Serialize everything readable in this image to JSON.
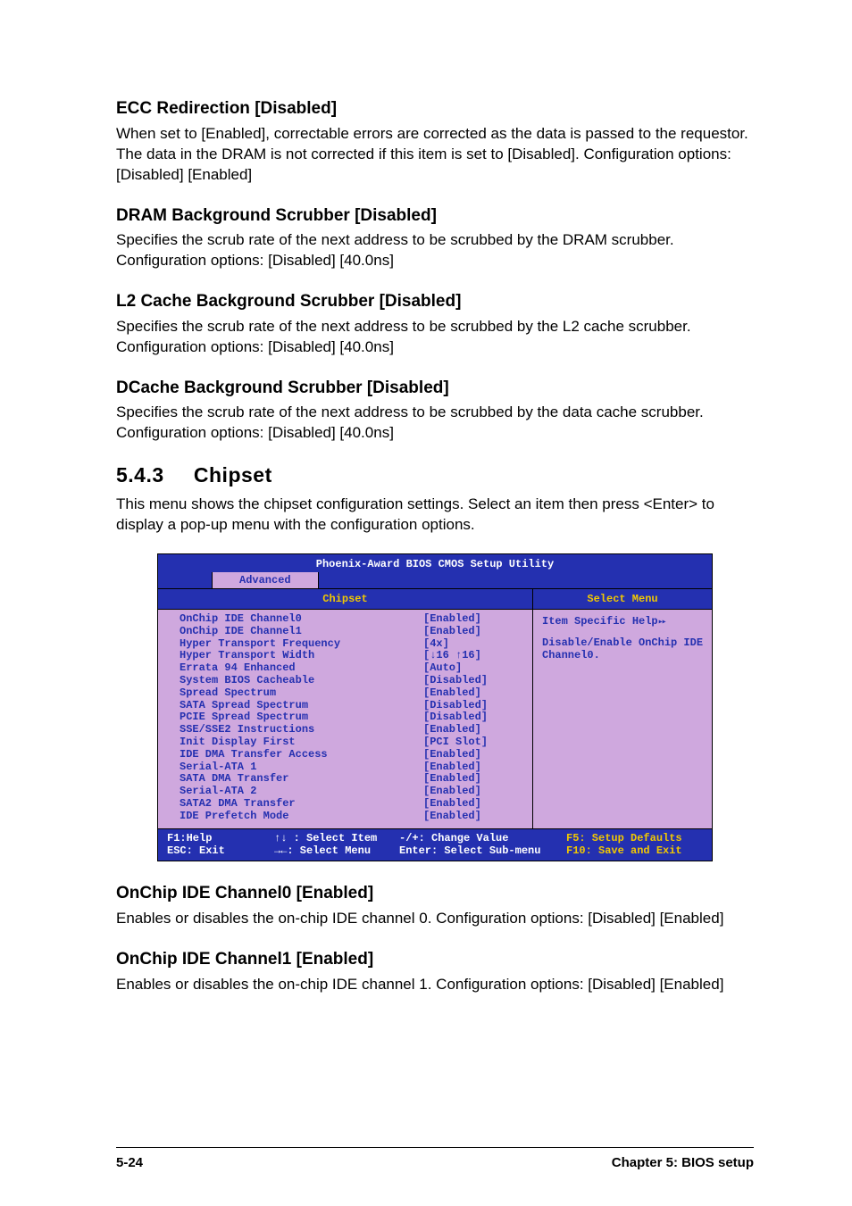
{
  "sections": {
    "ecc": {
      "heading": "ECC Redirection [Disabled]",
      "body": "When set to [Enabled], correctable errors are corrected as the data is passed to the requestor. The data in the DRAM is not corrected if this item is set to [Disabled]. Configuration options: [Disabled] [Enabled]"
    },
    "dram": {
      "heading": "DRAM Background Scrubber [Disabled]",
      "body": "Specifies the scrub rate of the next address to be scrubbed by the DRAM scrubber. Configuration options: [Disabled] [40.0ns]"
    },
    "l2": {
      "heading": "L2 Cache Background Scrubber [Disabled]",
      "body": "Specifies the scrub rate of the next address to be scrubbed by the L2 cache scrubber. Configuration options: [Disabled] [40.0ns]"
    },
    "dcache": {
      "heading": "DCache Background Scrubber [Disabled]",
      "body": "Specifies the scrub rate of the next address to be scrubbed by the data cache scrubber. Configuration options: [Disabled] [40.0ns]"
    },
    "onchip0": {
      "heading": "OnChip IDE Channel0 [Enabled]",
      "body": "Enables or disables the on-chip IDE channel 0. Configuration options: [Disabled] [Enabled]"
    },
    "onchip1": {
      "heading": "OnChip IDE Channel1 [Enabled]",
      "body": "Enables or disables the on-chip IDE channel 1. Configuration options: [Disabled] [Enabled]"
    }
  },
  "chapter": {
    "num": "5.4.3",
    "title": "Chipset",
    "intro": "This menu shows the chipset configuration settings. Select an item then press <Enter> to display a pop-up menu with the configuration options."
  },
  "bios": {
    "utility_title": "Phoenix-Award BIOS CMOS Setup Utility",
    "active_tab": "Advanced",
    "left_heading": "Chipset",
    "right_heading": "Select Menu",
    "help_title": "Item Specific Help",
    "help_body": "Disable/Enable OnChip IDE Channel0.",
    "settings": [
      {
        "label": "OnChip IDE Channel0",
        "value": "[Enabled]"
      },
      {
        "label": "OnChip IDE Channel1",
        "value": "[Enabled]"
      },
      {
        "label": "Hyper Transport Frequency",
        "value": "[4x]"
      },
      {
        "label": "Hyper Transport Width",
        "value": "[↓16 ↑16]"
      },
      {
        "label": "Errata 94 Enhanced",
        "value": "[Auto]"
      },
      {
        "label": "System BIOS Cacheable",
        "value": "[Disabled]"
      },
      {
        "label": "Spread Spectrum",
        "value": "[Enabled]"
      },
      {
        "label": "SATA Spread Spectrum",
        "value": "[Disabled]"
      },
      {
        "label": "PCIE Spread Spectrum",
        "value": "[Disabled]"
      },
      {
        "label": "SSE/SSE2 Instructions",
        "value": "[Enabled]"
      },
      {
        "label": "Init Display First",
        "value": "[PCI Slot]"
      },
      {
        "label": "IDE DMA Transfer Access",
        "value": "[Enabled]"
      },
      {
        "label": "Serial-ATA 1",
        "value": "[Enabled]"
      },
      {
        "label": "SATA DMA Transfer",
        "value": "[Enabled]"
      },
      {
        "label": "Serial-ATA 2",
        "value": "[Enabled]"
      },
      {
        "label": "SATA2 DMA Transfer",
        "value": "[Enabled]"
      },
      {
        "label": "IDE Prefetch Mode",
        "value": "[Enabled]"
      }
    ],
    "footer": {
      "row1": {
        "c1": "F1:Help",
        "c2": "↑↓ : Select Item",
        "c3": "-/+: Change Value",
        "c4": "F5: Setup Defaults"
      },
      "row2": {
        "c1": "ESC: Exit",
        "c2": "→←: Select Menu",
        "c3": "Enter: Select Sub-menu",
        "c4": "F10: Save and Exit"
      }
    }
  },
  "page_footer": {
    "left": "5-24",
    "right": "Chapter 5: BIOS setup"
  }
}
